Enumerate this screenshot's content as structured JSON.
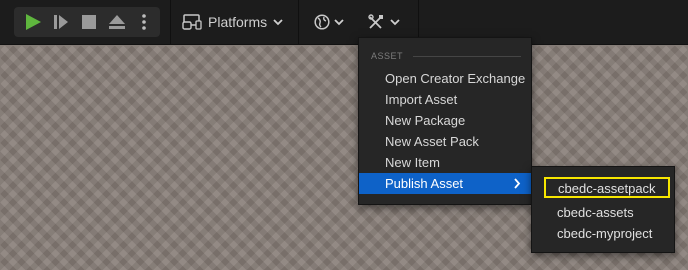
{
  "toolbar": {
    "platforms_label": "Platforms",
    "play_color": "#5fb63e",
    "icons": [
      "play-icon",
      "step-icon",
      "stop-icon",
      "eject-icon",
      "more-vertical-icon",
      "platforms-icon",
      "globe-icon",
      "tools-icon"
    ]
  },
  "menu": {
    "header": "ASSET",
    "items": [
      {
        "label": "Open Creator Exchange"
      },
      {
        "label": "Import Asset"
      },
      {
        "label": "New Package"
      },
      {
        "label": "New Asset Pack"
      },
      {
        "label": "New Item"
      },
      {
        "label": "Publish Asset",
        "active": true
      }
    ],
    "active_color": "#0e62c8"
  },
  "submenu": {
    "items": [
      {
        "label": "cbedc-assetpack",
        "highlighted": true
      },
      {
        "label": "cbedc-assets"
      },
      {
        "label": "cbedc-myproject"
      }
    ],
    "highlight_color": "#f7e600"
  }
}
